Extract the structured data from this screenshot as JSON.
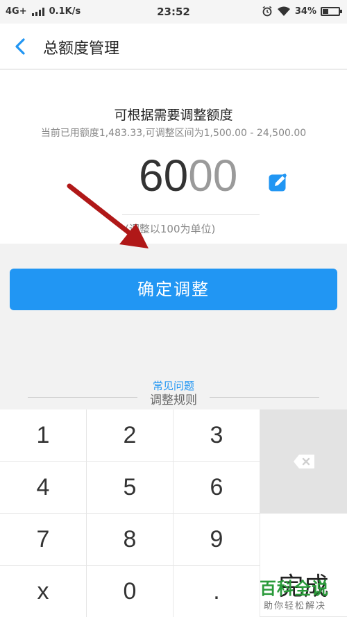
{
  "status_bar": {
    "network": "4G+",
    "speed": "0.1K/s",
    "time": "23:52",
    "battery": "34%",
    "battery_level": 0.34
  },
  "nav": {
    "title": "总额度管理"
  },
  "adjust": {
    "title": "可根据需要调整额度",
    "subtitle": "当前已用额度1,483.33,可调整区间为1,500.00 - 24,500.00",
    "amount_typed": "60",
    "amount_placeholder": "00",
    "unit_note": "(调整以100为单位)"
  },
  "confirm_button": {
    "label": "确定调整"
  },
  "links": {
    "faq": "常见问题",
    "rules": "调整规则"
  },
  "keypad": {
    "keys": [
      "1",
      "2",
      "3",
      "4",
      "5",
      "6",
      "7",
      "8",
      "9",
      "x",
      "0",
      "."
    ],
    "done": "完成"
  },
  "watermark": {
    "title": "百科全说",
    "subtitle": "助你轻松解决"
  },
  "colors": {
    "accent": "#2196f3",
    "annotation_arrow": "#b01818",
    "watermark_green": "#2a9a3a"
  },
  "icons": [
    "back-chevron-icon",
    "edit-icon",
    "backspace-icon",
    "signal-icon",
    "wifi-icon",
    "alarm-icon",
    "battery-icon"
  ]
}
